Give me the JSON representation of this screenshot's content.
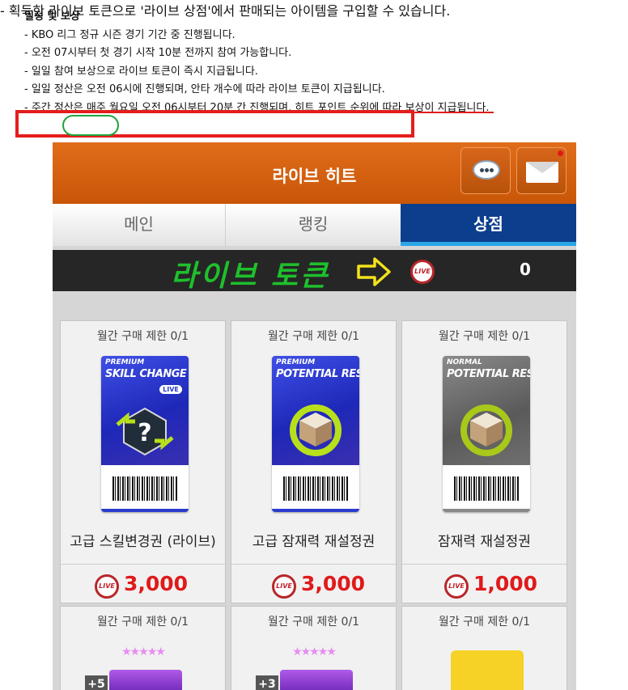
{
  "notice": {
    "title": "일정 및 보상",
    "lines": [
      "- KBO 리그 정규 시즌 경기 기간 중 진행됩니다.",
      "- 오전 07시부터 첫 경기 시작 10분 전까지 참여 가능합니다.",
      "- 일일 참여 보상으로 라이브 토큰이 즉시 지급됩니다.",
      "- 일일 정산은 오전 06시에 진행되며, 안타 개수에 따라 라이브 토큰이 지급됩니다.",
      "- 주간 정산은 매주 월요일 오전 06시부터 20분 간 진행되며, 히트 포인트 순위에 따라 보상이 지급됩니다."
    ],
    "highlighted_line": "- 획득한 라이브 토큰으로 '라이브 상점'에서 판매되는 아이템을 구입할 수 있습니다."
  },
  "game": {
    "header_title": "라이브 히트",
    "tabs": [
      "메인",
      "랭킹",
      "상점"
    ],
    "active_tab": "상점",
    "token_label": "라이브 토큰",
    "token_icon_text": "LIVE",
    "token_count": "0",
    "products": [
      {
        "limit": "월간 구매 제한 0/1",
        "ticket_tier": "PREMIUM",
        "ticket_title": "SKILL CHANGE",
        "ticket_tag": "LIVE",
        "name": "고급 스킬변경권 (라이브)",
        "price": "3,000"
      },
      {
        "limit": "월간 구매 제한 0/1",
        "ticket_tier": "PREMIUM",
        "ticket_title": "POTENTIAL RESET",
        "name": "고급 잠재력 재설정권",
        "price": "3,000"
      },
      {
        "limit": "월간 구매 제한 0/1",
        "ticket_tier": "NORMAL",
        "ticket_title": "POTENTIAL RESET",
        "name": "잠재력 재설정권",
        "price": "1,000"
      },
      {
        "limit": "월간 구매 제한 0/1",
        "badge": "+5"
      },
      {
        "limit": "월간 구매 제한 0/1",
        "badge": "+3"
      },
      {
        "limit": "월간 구매 제한 0/1"
      }
    ],
    "colors": {
      "header_orange": "#d9651a",
      "shop_tab_blue": "#0c3e8e",
      "token_green": "#1ec02c",
      "price_red": "#e01a1a",
      "highlight_red": "#e51d1d"
    }
  }
}
